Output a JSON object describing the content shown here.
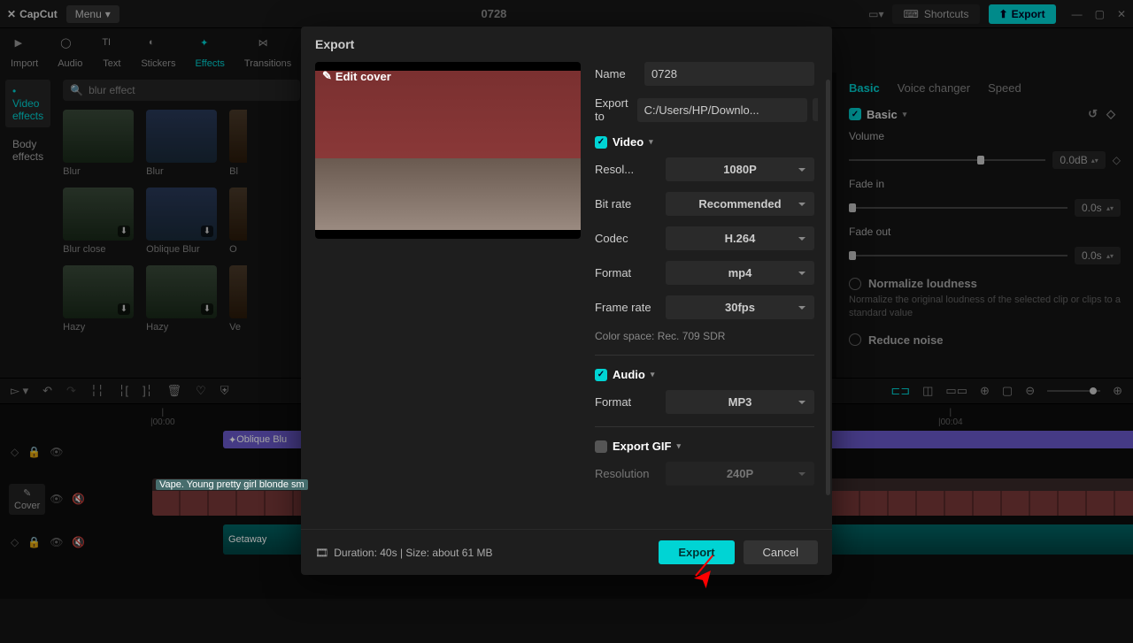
{
  "titlebar": {
    "app": "CapCut",
    "menu": "Menu",
    "project": "0728",
    "shortcuts": "Shortcuts",
    "export": "Export"
  },
  "tools": {
    "import": "Import",
    "audio": "Audio",
    "text": "Text",
    "stickers": "Stickers",
    "effects": "Effects",
    "transitions": "Transitions"
  },
  "left_tabs": {
    "video_effects": "Video effects",
    "body_effects": "Body effects"
  },
  "search": {
    "placeholder": "blur effect"
  },
  "thumbs": [
    {
      "label": "Blur"
    },
    {
      "label": "Blur"
    },
    {
      "label": "Bl"
    },
    {
      "label": "Blur close"
    },
    {
      "label": "Oblique Blur"
    },
    {
      "label": "O"
    },
    {
      "label": "Hazy"
    },
    {
      "label": "Hazy"
    },
    {
      "label": "Ve"
    }
  ],
  "rp": {
    "tabs": {
      "basic": "Basic",
      "voice": "Voice changer",
      "speed": "Speed"
    },
    "basic": "Basic",
    "volume": "Volume",
    "volume_val": "0.0dB",
    "fade_in": "Fade in",
    "fade_in_val": "0.0s",
    "fade_out": "Fade out",
    "fade_out_val": "0.0s",
    "normalize": "Normalize loudness",
    "normalize_desc": "Normalize the original loudness of the selected clip or clips to a standard value",
    "reduce_noise": "Reduce noise"
  },
  "ruler": {
    "t0": "|00:00",
    "t4": "|00:04"
  },
  "timeline": {
    "cover": "Cover",
    "effect_clip": "Oblique Blu",
    "video_clip": "Vape. Young pretty girl blonde sm",
    "audio_clip": "Getaway"
  },
  "modal": {
    "title": "Export",
    "edit_cover": "Edit cover",
    "name": "Name",
    "name_val": "0728",
    "export_to": "Export to",
    "path": "C:/Users/HP/Downlo...",
    "video": "Video",
    "resolution": "Resol...",
    "resolution_val": "1080P",
    "bitrate": "Bit rate",
    "bitrate_val": "Recommended",
    "codec": "Codec",
    "codec_val": "H.264",
    "format": "Format",
    "format_val": "mp4",
    "frame_rate": "Frame rate",
    "frame_rate_val": "30fps",
    "color_space": "Color space: Rec. 709 SDR",
    "audio": "Audio",
    "audio_format": "Format",
    "audio_format_val": "MP3",
    "export_gif": "Export GIF",
    "gif_res": "Resolution",
    "gif_res_val": "240P",
    "duration_size": "Duration: 40s | Size: about 61 MB",
    "export_btn": "Export",
    "cancel_btn": "Cancel"
  }
}
